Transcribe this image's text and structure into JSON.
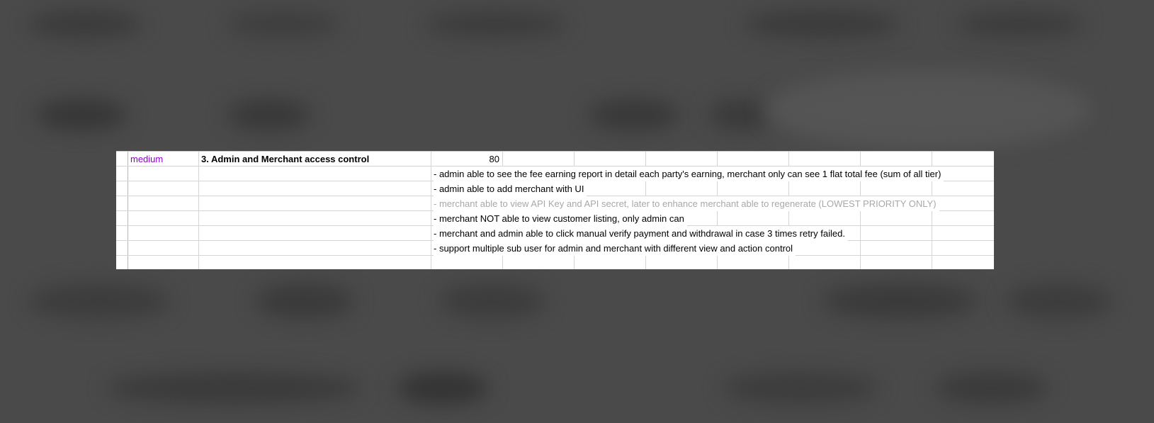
{
  "sheet": {
    "rows": [
      {
        "priority": "medium",
        "title": "3. Admin and Merchant access control",
        "points": "80",
        "requirement": "",
        "muted": false
      },
      {
        "priority": "",
        "title": "",
        "points": "",
        "requirement": "- admin able to see the fee earning report in detail each party's earning, merchant only can see 1 flat total fee (sum of all tier)",
        "muted": false
      },
      {
        "priority": "",
        "title": "",
        "points": "",
        "requirement": "- admin able to add merchant with UI",
        "muted": false
      },
      {
        "priority": "",
        "title": "",
        "points": "",
        "requirement": "- merchant able to view API Key and API secret, later to enhance merchant able to regenerate (LOWEST PRIORITY ONLY)",
        "muted": true
      },
      {
        "priority": "",
        "title": "",
        "points": "",
        "requirement": "- merchant NOT able to view customer listing, only admin can",
        "muted": false
      },
      {
        "priority": "",
        "title": "",
        "points": "",
        "requirement": "- merchant and admin able to click manual verify payment and withdrawal in case 3 times retry failed.",
        "muted": false
      },
      {
        "priority": "",
        "title": "",
        "points": "",
        "requirement": "- support multiple sub user for admin and merchant with different view and action control",
        "muted": false
      },
      {
        "priority": "",
        "title": "",
        "points": "",
        "requirement": "",
        "muted": false
      }
    ],
    "colors": {
      "priority_text": "#8a00cc",
      "muted_text": "#a8a8a8",
      "grid_line": "#d4d4d4"
    }
  }
}
